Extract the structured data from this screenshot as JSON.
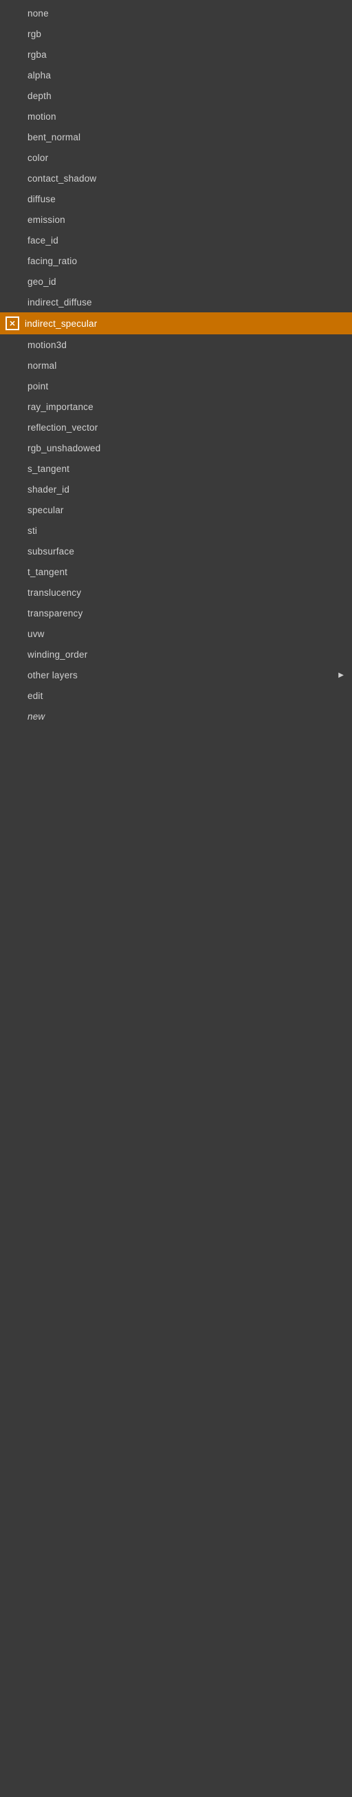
{
  "menu": {
    "items": [
      {
        "id": "none",
        "label": "none",
        "active": false,
        "italic": false,
        "hasArrow": false,
        "hasIcon": false
      },
      {
        "id": "rgb",
        "label": "rgb",
        "active": false,
        "italic": false,
        "hasArrow": false,
        "hasIcon": false
      },
      {
        "id": "rgba",
        "label": "rgba",
        "active": false,
        "italic": false,
        "hasArrow": false,
        "hasIcon": false
      },
      {
        "id": "alpha",
        "label": "alpha",
        "active": false,
        "italic": false,
        "hasArrow": false,
        "hasIcon": false
      },
      {
        "id": "depth",
        "label": "depth",
        "active": false,
        "italic": false,
        "hasArrow": false,
        "hasIcon": false
      },
      {
        "id": "motion",
        "label": "motion",
        "active": false,
        "italic": false,
        "hasArrow": false,
        "hasIcon": false
      },
      {
        "id": "bent_normal",
        "label": "bent_normal",
        "active": false,
        "italic": false,
        "hasArrow": false,
        "hasIcon": false
      },
      {
        "id": "color",
        "label": "color",
        "active": false,
        "italic": false,
        "hasArrow": false,
        "hasIcon": false
      },
      {
        "id": "contact_shadow",
        "label": "contact_shadow",
        "active": false,
        "italic": false,
        "hasArrow": false,
        "hasIcon": false
      },
      {
        "id": "diffuse",
        "label": "diffuse",
        "active": false,
        "italic": false,
        "hasArrow": false,
        "hasIcon": false
      },
      {
        "id": "emission",
        "label": "emission",
        "active": false,
        "italic": false,
        "hasArrow": false,
        "hasIcon": false
      },
      {
        "id": "face_id",
        "label": "face_id",
        "active": false,
        "italic": false,
        "hasArrow": false,
        "hasIcon": false
      },
      {
        "id": "facing_ratio",
        "label": "facing_ratio",
        "active": false,
        "italic": false,
        "hasArrow": false,
        "hasIcon": false
      },
      {
        "id": "geo_id",
        "label": "geo_id",
        "active": false,
        "italic": false,
        "hasArrow": false,
        "hasIcon": false
      },
      {
        "id": "indirect_diffuse",
        "label": "indirect_diffuse",
        "active": false,
        "italic": false,
        "hasArrow": false,
        "hasIcon": false
      },
      {
        "id": "indirect_specular",
        "label": "indirect_specular",
        "active": true,
        "italic": false,
        "hasArrow": false,
        "hasIcon": true
      },
      {
        "id": "motion3d",
        "label": "motion3d",
        "active": false,
        "italic": false,
        "hasArrow": false,
        "hasIcon": false
      },
      {
        "id": "normal",
        "label": "normal",
        "active": false,
        "italic": false,
        "hasArrow": false,
        "hasIcon": false
      },
      {
        "id": "point",
        "label": "point",
        "active": false,
        "italic": false,
        "hasArrow": false,
        "hasIcon": false
      },
      {
        "id": "ray_importance",
        "label": "ray_importance",
        "active": false,
        "italic": false,
        "hasArrow": false,
        "hasIcon": false
      },
      {
        "id": "reflection_vector",
        "label": "reflection_vector",
        "active": false,
        "italic": false,
        "hasArrow": false,
        "hasIcon": false
      },
      {
        "id": "rgb_unshadowed",
        "label": "rgb_unshadowed",
        "active": false,
        "italic": false,
        "hasArrow": false,
        "hasIcon": false
      },
      {
        "id": "s_tangent",
        "label": "s_tangent",
        "active": false,
        "italic": false,
        "hasArrow": false,
        "hasIcon": false
      },
      {
        "id": "shader_id",
        "label": "shader_id",
        "active": false,
        "italic": false,
        "hasArrow": false,
        "hasIcon": false
      },
      {
        "id": "specular",
        "label": "specular",
        "active": false,
        "italic": false,
        "hasArrow": false,
        "hasIcon": false
      },
      {
        "id": "sti",
        "label": "sti",
        "active": false,
        "italic": false,
        "hasArrow": false,
        "hasIcon": false
      },
      {
        "id": "subsurface",
        "label": "subsurface",
        "active": false,
        "italic": false,
        "hasArrow": false,
        "hasIcon": false
      },
      {
        "id": "t_tangent",
        "label": "t_tangent",
        "active": false,
        "italic": false,
        "hasArrow": false,
        "hasIcon": false
      },
      {
        "id": "translucency",
        "label": "translucency",
        "active": false,
        "italic": false,
        "hasArrow": false,
        "hasIcon": false
      },
      {
        "id": "transparency",
        "label": "transparency",
        "active": false,
        "italic": false,
        "hasArrow": false,
        "hasIcon": false
      },
      {
        "id": "uvw",
        "label": "uvw",
        "active": false,
        "italic": false,
        "hasArrow": false,
        "hasIcon": false
      },
      {
        "id": "winding_order",
        "label": "winding_order",
        "active": false,
        "italic": false,
        "hasArrow": false,
        "hasIcon": false
      },
      {
        "id": "other_layers",
        "label": "other layers",
        "active": false,
        "italic": false,
        "hasArrow": true,
        "hasIcon": false
      },
      {
        "id": "edit",
        "label": "edit",
        "active": false,
        "italic": false,
        "hasArrow": false,
        "hasIcon": false
      },
      {
        "id": "new",
        "label": "new",
        "active": false,
        "italic": true,
        "hasArrow": false,
        "hasIcon": false
      }
    ],
    "active_icon_label": "✕",
    "colors": {
      "background": "#3a3a3a",
      "active_bg": "#c87000",
      "text": "#d0d0d0",
      "active_text": "#ffffff"
    }
  }
}
